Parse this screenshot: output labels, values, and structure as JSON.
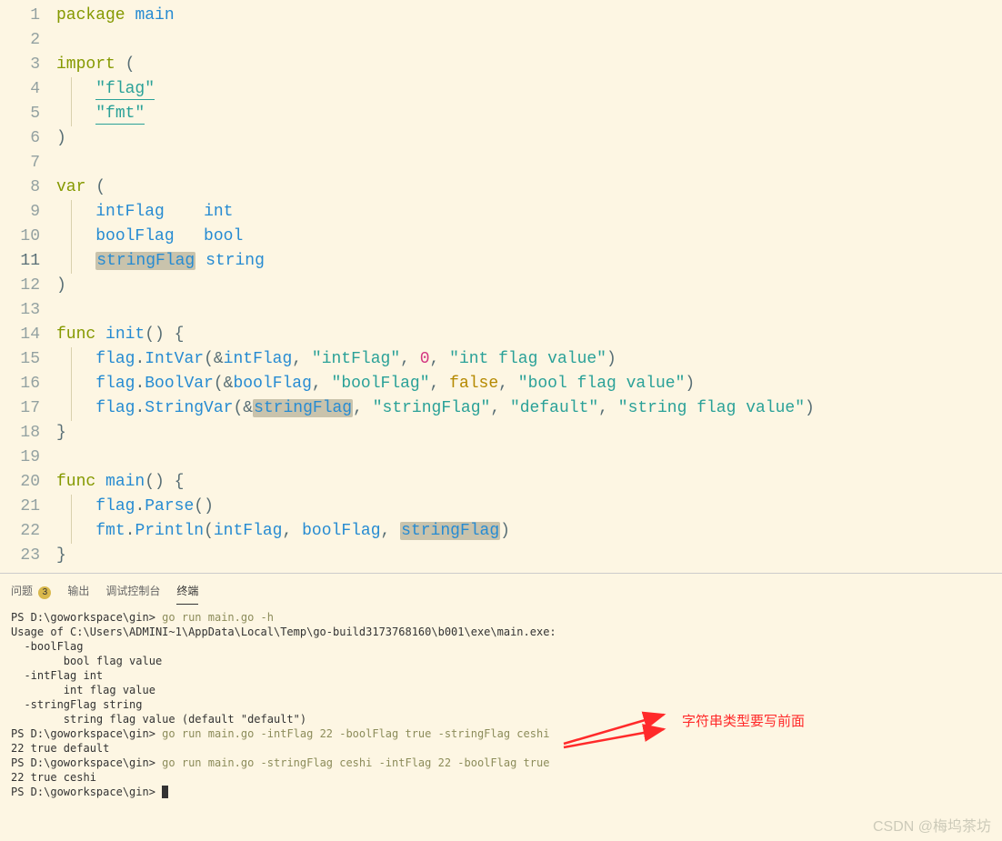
{
  "editor": {
    "lines": [
      {
        "num": "1",
        "tokens": [
          [
            "kw",
            "package"
          ],
          [
            "plain",
            " "
          ],
          [
            "ident",
            "main"
          ]
        ]
      },
      {
        "num": "2",
        "tokens": []
      },
      {
        "num": "3",
        "tokens": [
          [
            "kw",
            "import"
          ],
          [
            "plain",
            " "
          ],
          [
            "punct",
            "("
          ]
        ]
      },
      {
        "num": "4",
        "tokens": [
          [
            "plain",
            "    "
          ],
          [
            "str underline",
            "\"flag\""
          ]
        ]
      },
      {
        "num": "5",
        "tokens": [
          [
            "plain",
            "    "
          ],
          [
            "str underline",
            "\"fmt\""
          ]
        ]
      },
      {
        "num": "6",
        "tokens": [
          [
            "punct",
            ")"
          ]
        ]
      },
      {
        "num": "7",
        "tokens": []
      },
      {
        "num": "8",
        "tokens": [
          [
            "kw",
            "var"
          ],
          [
            "plain",
            " "
          ],
          [
            "punct",
            "("
          ]
        ]
      },
      {
        "num": "9",
        "tokens": [
          [
            "plain",
            "    "
          ],
          [
            "ident",
            "intFlag"
          ],
          [
            "plain",
            "    "
          ],
          [
            "type",
            "int"
          ]
        ]
      },
      {
        "num": "10",
        "tokens": [
          [
            "plain",
            "    "
          ],
          [
            "ident",
            "boolFlag"
          ],
          [
            "plain",
            "   "
          ],
          [
            "type",
            "bool"
          ]
        ]
      },
      {
        "num": "11",
        "cur": true,
        "tokens": [
          [
            "plain",
            "    "
          ],
          [
            "ident hl",
            "stringFlag"
          ],
          [
            "plain",
            " "
          ],
          [
            "type",
            "string"
          ]
        ]
      },
      {
        "num": "12",
        "tokens": [
          [
            "punct",
            ")"
          ]
        ]
      },
      {
        "num": "13",
        "tokens": []
      },
      {
        "num": "14",
        "tokens": [
          [
            "kw",
            "func"
          ],
          [
            "plain",
            " "
          ],
          [
            "fn",
            "init"
          ],
          [
            "punct",
            "()"
          ],
          [
            "plain",
            " "
          ],
          [
            "punct",
            "{"
          ]
        ]
      },
      {
        "num": "15",
        "tokens": [
          [
            "plain",
            "    "
          ],
          [
            "ident",
            "flag"
          ],
          [
            "punct",
            "."
          ],
          [
            "fn",
            "IntVar"
          ],
          [
            "punct",
            "(&"
          ],
          [
            "ident",
            "intFlag"
          ],
          [
            "punct",
            ", "
          ],
          [
            "str",
            "\"intFlag\""
          ],
          [
            "punct",
            ", "
          ],
          [
            "num",
            "0"
          ],
          [
            "punct",
            ", "
          ],
          [
            "str",
            "\"int flag value\""
          ],
          [
            "punct",
            ")"
          ]
        ]
      },
      {
        "num": "16",
        "tokens": [
          [
            "plain",
            "    "
          ],
          [
            "ident",
            "flag"
          ],
          [
            "punct",
            "."
          ],
          [
            "fn",
            "BoolVar"
          ],
          [
            "punct",
            "(&"
          ],
          [
            "ident",
            "boolFlag"
          ],
          [
            "punct",
            ", "
          ],
          [
            "str",
            "\"boolFlag\""
          ],
          [
            "punct",
            ", "
          ],
          [
            "lit",
            "false"
          ],
          [
            "punct",
            ", "
          ],
          [
            "str",
            "\"bool flag value\""
          ],
          [
            "punct",
            ")"
          ]
        ]
      },
      {
        "num": "17",
        "tokens": [
          [
            "plain",
            "    "
          ],
          [
            "ident",
            "flag"
          ],
          [
            "punct",
            "."
          ],
          [
            "fn",
            "StringVar"
          ],
          [
            "punct",
            "(&"
          ],
          [
            "ident hl",
            "stringFlag"
          ],
          [
            "punct",
            ", "
          ],
          [
            "str",
            "\"stringFlag\""
          ],
          [
            "punct",
            ", "
          ],
          [
            "str",
            "\"default\""
          ],
          [
            "punct",
            ", "
          ],
          [
            "str",
            "\"string flag value\""
          ],
          [
            "punct",
            ")"
          ]
        ]
      },
      {
        "num": "18",
        "tokens": [
          [
            "punct",
            "}"
          ]
        ]
      },
      {
        "num": "19",
        "tokens": []
      },
      {
        "num": "20",
        "tokens": [
          [
            "kw",
            "func"
          ],
          [
            "plain",
            " "
          ],
          [
            "fn",
            "main"
          ],
          [
            "punct",
            "()"
          ],
          [
            "plain",
            " "
          ],
          [
            "punct",
            "{"
          ]
        ]
      },
      {
        "num": "21",
        "tokens": [
          [
            "plain",
            "    "
          ],
          [
            "ident",
            "flag"
          ],
          [
            "punct",
            "."
          ],
          [
            "fn",
            "Parse"
          ],
          [
            "punct",
            "()"
          ]
        ]
      },
      {
        "num": "22",
        "tokens": [
          [
            "plain",
            "    "
          ],
          [
            "ident",
            "fmt"
          ],
          [
            "punct",
            "."
          ],
          [
            "fn",
            "Println"
          ],
          [
            "punct",
            "("
          ],
          [
            "ident",
            "intFlag"
          ],
          [
            "punct",
            ", "
          ],
          [
            "ident",
            "boolFlag"
          ],
          [
            "punct",
            ", "
          ],
          [
            "ident hl",
            "stringFlag"
          ],
          [
            "punct",
            ")"
          ]
        ]
      },
      {
        "num": "23",
        "tokens": [
          [
            "punct",
            "}"
          ]
        ]
      }
    ]
  },
  "tabs": {
    "problems": "问题",
    "problems_count": "3",
    "output": "输出",
    "debug": "调试控制台",
    "terminal": "终端"
  },
  "terminal": [
    {
      "type": "cmd",
      "prompt": "PS D:\\goworkspace\\gin> ",
      "cmd": "go run main.go -h"
    },
    {
      "type": "out",
      "text": "Usage of C:\\Users\\ADMINI~1\\AppData\\Local\\Temp\\go-build3173768160\\b001\\exe\\main.exe:"
    },
    {
      "type": "out",
      "text": "  -boolFlag"
    },
    {
      "type": "out",
      "text": "        bool flag value"
    },
    {
      "type": "out",
      "text": "  -intFlag int"
    },
    {
      "type": "out",
      "text": "        int flag value"
    },
    {
      "type": "out",
      "text": "  -stringFlag string"
    },
    {
      "type": "out",
      "text": "        string flag value (default \"default\")"
    },
    {
      "type": "cmd",
      "prompt": "PS D:\\goworkspace\\gin> ",
      "cmd": "go run main.go -intFlag 22 -boolFlag true -stringFlag ceshi"
    },
    {
      "type": "out",
      "text": "22 true default"
    },
    {
      "type": "cmd",
      "prompt": "PS D:\\goworkspace\\gin> ",
      "cmd": "go run main.go -stringFlag ceshi -intFlag 22 -boolFlag true"
    },
    {
      "type": "out",
      "text": "22 true ceshi"
    },
    {
      "type": "cursor",
      "prompt": "PS D:\\goworkspace\\gin> "
    }
  ],
  "annotation": "字符串类型要写前面",
  "watermark": "CSDN @梅坞茶坊"
}
